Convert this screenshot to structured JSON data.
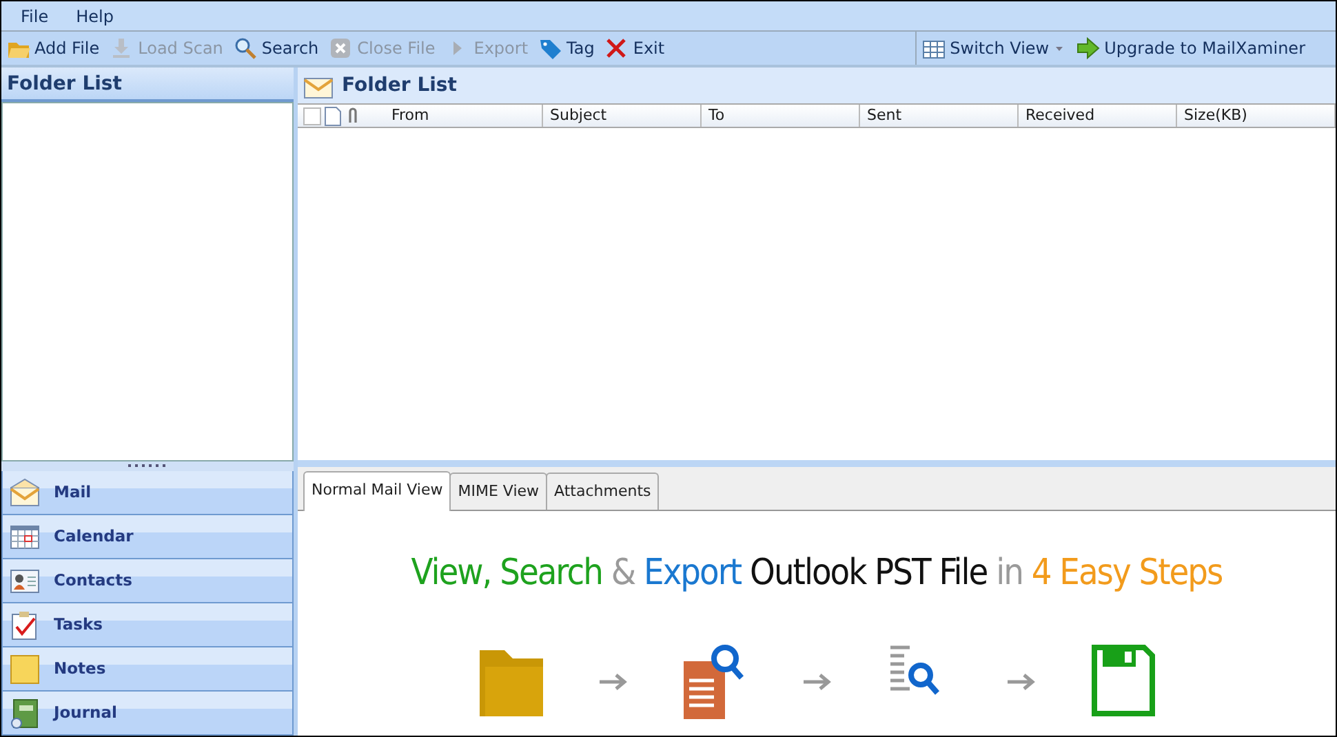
{
  "menu": [
    "File",
    "Help"
  ],
  "toolbar": [
    {
      "label": "Add File",
      "kind": "add",
      "disabled": false
    },
    {
      "label": "Load Scan",
      "kind": "load",
      "disabled": true
    },
    {
      "label": "Search",
      "kind": "search",
      "disabled": false
    },
    {
      "label": "Close File",
      "kind": "close",
      "disabled": true
    },
    {
      "label": "Export",
      "kind": "export",
      "disabled": true
    },
    {
      "label": "Tag",
      "kind": "tag",
      "disabled": false
    },
    {
      "label": "Exit",
      "kind": "exit",
      "disabled": false
    }
  ],
  "toolbar_right": [
    {
      "label": "Switch View",
      "kind": "switch"
    },
    {
      "label": "Upgrade to MailXaminer",
      "kind": "upgrade"
    }
  ],
  "left_panel": {
    "title": "Folder List"
  },
  "nav": [
    {
      "label": "Mail",
      "kind": "mail"
    },
    {
      "label": "Calendar",
      "kind": "calendar"
    },
    {
      "label": "Contacts",
      "kind": "contacts"
    },
    {
      "label": "Tasks",
      "kind": "tasks"
    },
    {
      "label": "Notes",
      "kind": "notes"
    },
    {
      "label": "Journal",
      "kind": "journal"
    }
  ],
  "list_panel": {
    "title": "Folder List",
    "select_all_checked": false,
    "columns": [
      "From",
      "Subject",
      "To",
      "Sent",
      "Received",
      "Size(KB)"
    ]
  },
  "tabs": [
    {
      "label": "Normal Mail View",
      "selected": true
    },
    {
      "label": "MIME View",
      "selected": false
    },
    {
      "label": "Attachments",
      "selected": false
    }
  ],
  "headline": [
    {
      "text": "View, Search",
      "color": "#1ea21e"
    },
    {
      "text": "&",
      "color": "#9a9a9a"
    },
    {
      "text": "Export",
      "color": "#1a78d0"
    },
    {
      "text": "Outlook PST File",
      "color": "#111111"
    },
    {
      "text": "in",
      "color": "#9a9a9a"
    },
    {
      "text": "4 Easy Steps",
      "color": "#f29b1c"
    }
  ],
  "steps": [
    {
      "kind": "folder"
    },
    {
      "kind": "document"
    },
    {
      "kind": "list"
    },
    {
      "kind": "save"
    }
  ]
}
